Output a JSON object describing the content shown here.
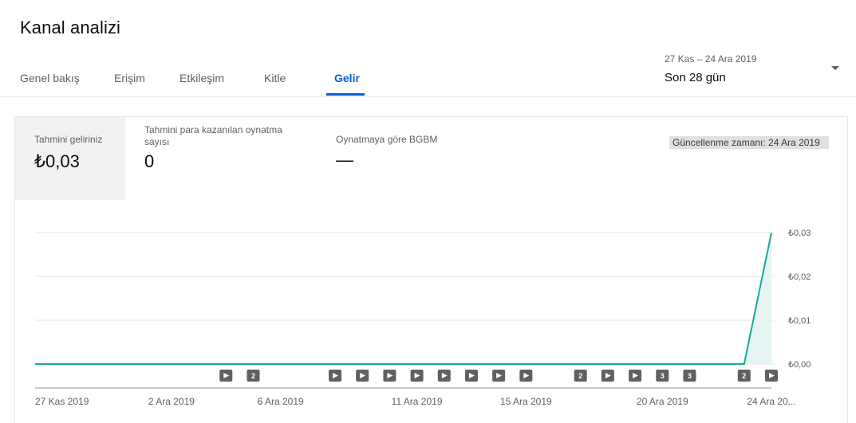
{
  "page_title": "Kanal analizi",
  "tabs": [
    {
      "label": "Genel bakış"
    },
    {
      "label": "Erişim"
    },
    {
      "label": "Etkileşim"
    },
    {
      "label": "Kitle"
    },
    {
      "label": "Gelir"
    }
  ],
  "active_tab": "Gelir",
  "date_range": {
    "sub": "27 Kas – 24 Ara 2019",
    "main": "Son 28 gün"
  },
  "metrics": [
    {
      "label": "Tahmini geliriniz",
      "value": "₺0,03"
    },
    {
      "label": "Tahmini para kazanılan oynatma sayısı",
      "value": "0"
    },
    {
      "label": "Oynatmaya göre BGBM",
      "value": "—"
    }
  ],
  "updated_badge": "Güncellenme zamanı: 24 Ara 2019",
  "colors": {
    "accent": "#065fd4",
    "line": "#1aa79b",
    "area": "#e6f5f4",
    "marker": "#606060"
  },
  "chart_data": {
    "type": "line",
    "x": [
      "27 Kas",
      "28 Kas",
      "29 Kas",
      "30 Kas",
      "1 Ara",
      "2 Ara",
      "3 Ara",
      "4 Ara",
      "5 Ara",
      "6 Ara",
      "7 Ara",
      "8 Ara",
      "9 Ara",
      "10 Ara",
      "11 Ara",
      "12 Ara",
      "13 Ara",
      "14 Ara",
      "15 Ara",
      "16 Ara",
      "17 Ara",
      "18 Ara",
      "19 Ara",
      "20 Ara",
      "21 Ara",
      "22 Ara",
      "23 Ara",
      "24 Ara"
    ],
    "series": [
      {
        "values": [
          0,
          0,
          0,
          0,
          0,
          0,
          0,
          0,
          0,
          0,
          0,
          0,
          0,
          0,
          0,
          0,
          0,
          0,
          0,
          0,
          0,
          0,
          0,
          0,
          0,
          0,
          0,
          0.03
        ]
      }
    ],
    "ylim": [
      0,
      0.03
    ],
    "y_ticks": [
      "₺0,03",
      "₺0,02",
      "₺0,01",
      "₺0,00"
    ],
    "x_tick_labels": [
      {
        "index": 0,
        "label": "27 Kas 2019"
      },
      {
        "index": 5,
        "label": "2 Ara 2019"
      },
      {
        "index": 9,
        "label": "6 Ara 2019"
      },
      {
        "index": 14,
        "label": "11 Ara 2019"
      },
      {
        "index": 18,
        "label": "15 Ara 2019"
      },
      {
        "index": 23,
        "label": "20 Ara 2019"
      },
      {
        "index": 27,
        "label": "24 Ara 20..."
      }
    ],
    "markers": [
      {
        "index": 7,
        "text": "▶"
      },
      {
        "index": 8,
        "text": "2"
      },
      {
        "index": 11,
        "text": "▶"
      },
      {
        "index": 12,
        "text": "▶"
      },
      {
        "index": 13,
        "text": "▶"
      },
      {
        "index": 14,
        "text": "▶"
      },
      {
        "index": 15,
        "text": "▶"
      },
      {
        "index": 16,
        "text": "▶"
      },
      {
        "index": 17,
        "text": "▶"
      },
      {
        "index": 18,
        "text": "▶"
      },
      {
        "index": 20,
        "text": "2"
      },
      {
        "index": 21,
        "text": "▶"
      },
      {
        "index": 22,
        "text": "▶"
      },
      {
        "index": 23,
        "text": "3"
      },
      {
        "index": 24,
        "text": "3"
      },
      {
        "index": 26,
        "text": "2"
      },
      {
        "index": 27,
        "text": "▶"
      }
    ],
    "grid": true
  }
}
